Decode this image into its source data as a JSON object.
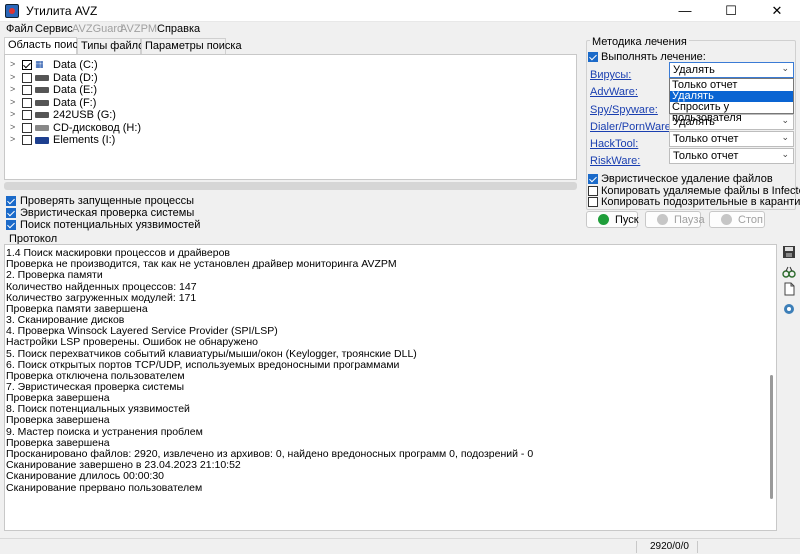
{
  "window": {
    "title": "Утилита AVZ",
    "minimize": "—",
    "maximize": "☐",
    "close": "✕"
  },
  "menu": {
    "file": "Файл",
    "service": "Сервис",
    "avzguard": "AVZGuard",
    "avzpm": "AVZPM",
    "help": "Справка"
  },
  "tabs": {
    "search_area": "Область поиска",
    "file_types": "Типы файлов",
    "search_params": "Параметры поиска"
  },
  "drives": [
    {
      "label": "Data (C:)",
      "checked": true
    },
    {
      "label": "Data (D:)",
      "checked": false
    },
    {
      "label": "Data (E:)",
      "checked": false
    },
    {
      "label": "Data (F:)",
      "checked": false
    },
    {
      "label": "242USB (G:)",
      "checked": false
    },
    {
      "label": "CD-дисковод (H:)",
      "checked": false
    },
    {
      "label": "Elements (I:)",
      "checked": false
    }
  ],
  "options": {
    "check_running": "Проверять запущенные процессы",
    "heuristic": "Эвристическая проверка системы",
    "vulnerabilities": "Поиск потенциальных уязвимостей"
  },
  "treatment": {
    "group_title": "Методика лечения",
    "perform": "Выполнять лечение:",
    "categories": [
      {
        "name": "Вирусы:",
        "value": "Удалять"
      },
      {
        "name": "AdvWare:",
        "value": ""
      },
      {
        "name": "Spy/Spyware:",
        "value": ""
      },
      {
        "name": "Dialer/PornWare:",
        "value": "Удалять"
      },
      {
        "name": "HackTool:",
        "value": "Только отчет"
      },
      {
        "name": "RiskWare:",
        "value": "Только отчет"
      }
    ],
    "dropdown_options": [
      "Только отчет",
      "Удалять",
      "Спросить у пользователя"
    ],
    "heuristic_delete": "Эвристическое удаление файлов",
    "copy_deleted": "Копировать удаляемые файлы в  Infected",
    "copy_suspicious": "Копировать подозрительные в  карантин"
  },
  "buttons": {
    "start": "Пуск",
    "pause": "Пауза",
    "stop": "Стоп"
  },
  "protocol": {
    "label": "Протокол",
    "lines": [
      "1.4 Поиск маскировки процессов и драйверов",
      " Проверка не производится, так как не установлен драйвер мониторинга AVZPM",
      "2. Проверка памяти",
      " Количество найденных процессов: 147",
      " Количество загруженных модулей: 171",
      "Проверка памяти завершена",
      "3. Сканирование дисков",
      "4. Проверка Winsock Layered Service Provider (SPI/LSP)",
      " Настройки LSP проверены. Ошибок не обнаружено",
      "5. Поиск перехватчиков событий клавиатуры/мыши/окон (Keylogger, троянские DLL)",
      "6. Поиск открытых портов TCP/UDP, используемых вредоносными программами",
      " Проверка отключена пользователем",
      "7. Эвристическая проверка системы",
      "Проверка завершена",
      "8. Поиск потенциальных уязвимостей",
      "Проверка завершена",
      "9. Мастер поиска и устранения проблем",
      "Проверка завершена",
      "Просканировано файлов: 2920, извлечено из архивов: 0, найдено вредоносных программ 0, подозрений - 0",
      "Сканирование завершено в 23.04.2023 21:10:52",
      "Сканирование длилось 00:00:30",
      "Сканирование прервано пользователем"
    ]
  },
  "status": {
    "counter": "2920/0/0"
  }
}
